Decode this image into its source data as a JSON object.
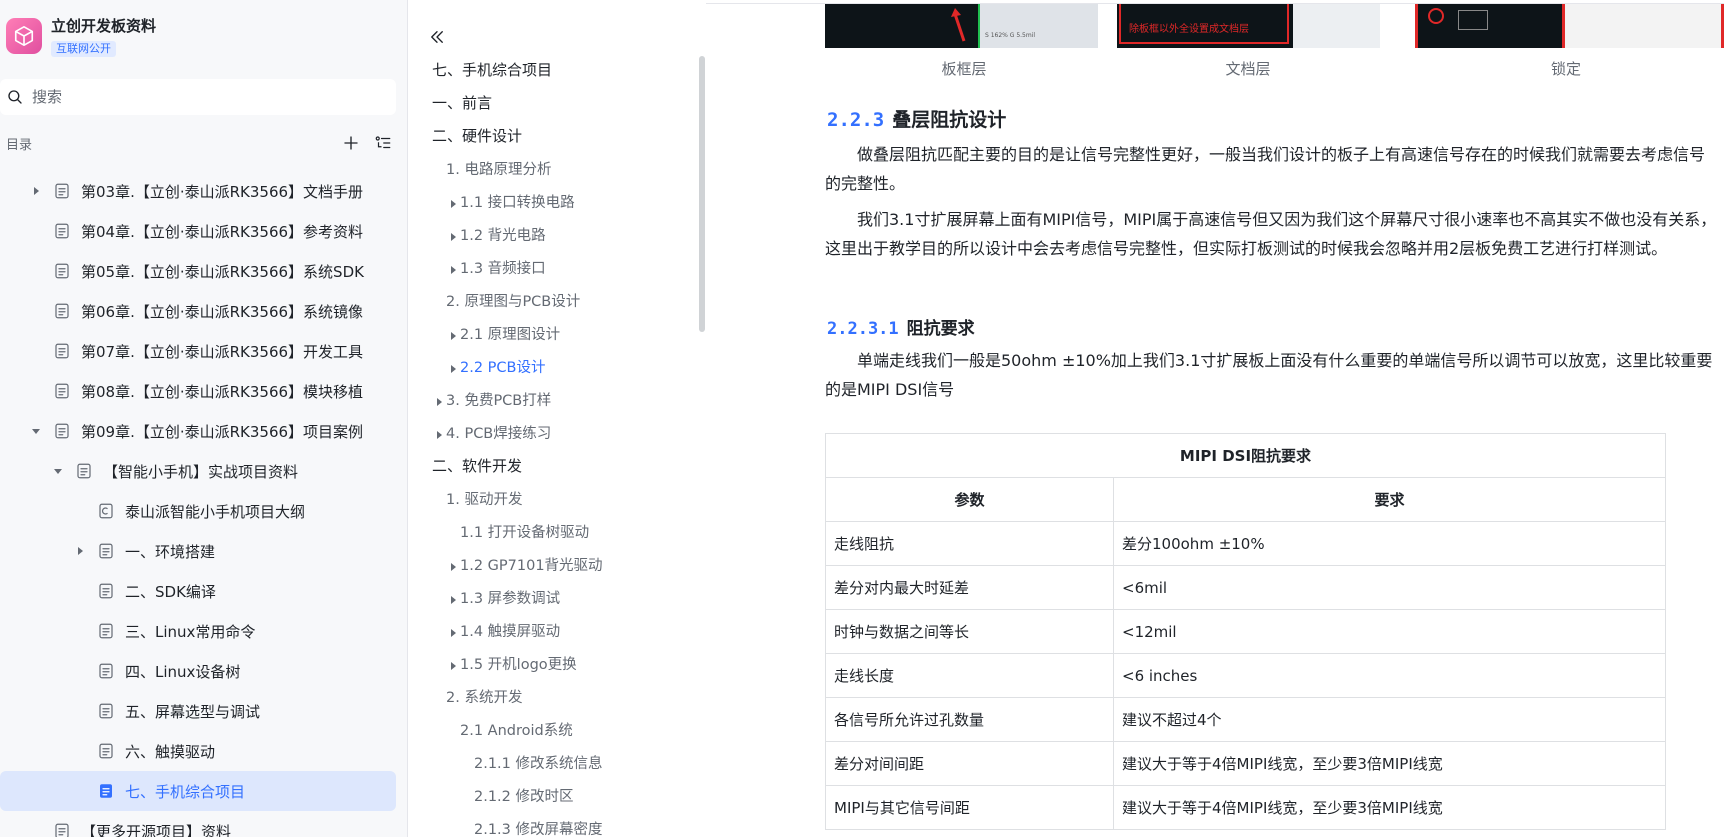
{
  "space": {
    "title": "立创开发板资料",
    "badge": "互联网公开"
  },
  "search": {
    "placeholder": "搜索"
  },
  "toc": {
    "label": "目录"
  },
  "tree": [
    {
      "label": "第03章.【立创·泰山派RK3566】文档手册",
      "expand": "collapsed"
    },
    {
      "label": "第04章.【立创·泰山派RK3566】参考资料",
      "expand": "none"
    },
    {
      "label": "第05章.【立创·泰山派RK3566】系统SDK",
      "expand": "none"
    },
    {
      "label": "第06章.【立创·泰山派RK3566】系统镜像",
      "expand": "none"
    },
    {
      "label": "第07章.【立创·泰山派RK3566】开发工具",
      "expand": "none"
    },
    {
      "label": "第08章.【立创·泰山派RK3566】模块移植",
      "expand": "none"
    },
    {
      "label": "第09章.【立创·泰山派RK3566】项目案例",
      "expand": "expanded"
    },
    {
      "label": "【智能小手机】实战项目资料",
      "expand": "expanded"
    },
    {
      "label": "泰山派智能小手机项目大纲",
      "expand": "none",
      "icon": "slides"
    },
    {
      "label": "一、环境搭建",
      "expand": "collapsed"
    },
    {
      "label": "二、SDK编译",
      "expand": "none"
    },
    {
      "label": "三、Linux常用命令",
      "expand": "none"
    },
    {
      "label": "四、Linux设备树",
      "expand": "none"
    },
    {
      "label": "五、屏幕选型与调试",
      "expand": "none"
    },
    {
      "label": "六、触摸驱动",
      "expand": "none"
    },
    {
      "label": "七、手机综合项目",
      "expand": "none",
      "active": true
    },
    {
      "label": "【更多开源项目】资料",
      "expand": "none"
    }
  ],
  "outline": [
    {
      "label": "七、手机综合项目",
      "caret": false
    },
    {
      "label": "一、前言",
      "caret": false
    },
    {
      "label": "二、硬件设计",
      "caret": false
    },
    {
      "label": "1. 电路原理分析",
      "caret": false
    },
    {
      "label": "1.1 接口转换电路",
      "caret": true
    },
    {
      "label": "1.2 背光电路",
      "caret": true
    },
    {
      "label": "1.3 音频接口",
      "caret": true
    },
    {
      "label": "2. 原理图与PCB设计",
      "caret": false
    },
    {
      "label": "2.1 原理图设计",
      "caret": true
    },
    {
      "label": "2.2 PCB设计",
      "caret": true,
      "active": true
    },
    {
      "label": "3. 免费PCB打样",
      "caret": true
    },
    {
      "label": "4. PCB焊接练习",
      "caret": true
    },
    {
      "label": "二、软件开发",
      "caret": false
    },
    {
      "label": "1. 驱动开发",
      "caret": false
    },
    {
      "label": "1.1 打开设备树驱动",
      "caret": false
    },
    {
      "label": "1.2 GP7101背光驱动",
      "caret": true
    },
    {
      "label": "1.3 屏参数调试",
      "caret": true
    },
    {
      "label": "1.4 触摸屏驱动",
      "caret": true
    },
    {
      "label": "1.5 开机logo更换",
      "caret": true
    },
    {
      "label": "2. 系统开发",
      "caret": false
    },
    {
      "label": "2.1 Android系统",
      "caret": false
    },
    {
      "label": "2.1.1 修改系统信息",
      "caret": false
    },
    {
      "label": "2.1.2 修改时区",
      "caret": false
    },
    {
      "label": "2.1.3 修改屏幕密度",
      "caret": false
    }
  ],
  "figures": {
    "captions": [
      "板框层",
      "文档层",
      "锁定"
    ],
    "thumb_b_text": "除板框以外全设置成文档层",
    "thumb_a_text": "S 162%    G 5.5mil"
  },
  "content": {
    "h3": {
      "num": "2.2.3",
      "text": "叠层阻抗设计"
    },
    "p1": "做叠层阻抗匹配主要的目的是让信号完整性更好，一般当我们设计的板子上有高速信号存在的时候我们就需要去考虑信号的完整性。",
    "p2": "我们3.1寸扩展屏幕上面有MIPI信号，MIPI属于高速信号但又因为我们这个屏幕尺寸很小速率也不高其实不做也没有关系，这里出于教学目的所以设计中会去考虑信号完整性，但实际打板测试的时候我会忽略并用2层板免费工艺进行打样测试。",
    "h4": {
      "num": "2.2.3.1",
      "text": "阻抗要求"
    },
    "p3": "单端走线我们一般是50ohm ±10%加上我们3.1寸扩展板上面没有什么重要的单端信号所以调节可以放宽，这里比较重要的是MIPI DSI信号"
  },
  "table": {
    "caption": "MIPI DSI阻抗要求",
    "headers": [
      "参数",
      "要求"
    ],
    "rows": [
      [
        "走线阻抗",
        "差分100ohm ±10%"
      ],
      [
        "差分对内最大时延差",
        "<6mil"
      ],
      [
        "时钟与数据之间等长",
        "<12mil"
      ],
      [
        "走线长度",
        "<6 inches"
      ],
      [
        "各信号所允许过孔数量",
        "建议不超过4个"
      ],
      [
        "差分对间间距",
        "建议大于等于4倍MIPI线宽，至少要3倍MIPI线宽"
      ],
      [
        "MIPI与其它信号间距",
        "建议大于等于4倍MIPI线宽，至少要3倍MIPI线宽"
      ]
    ]
  },
  "colors": {
    "accent": "#3370ff",
    "active_bg": "#dde7fd",
    "logo": "#e04fa0"
  }
}
